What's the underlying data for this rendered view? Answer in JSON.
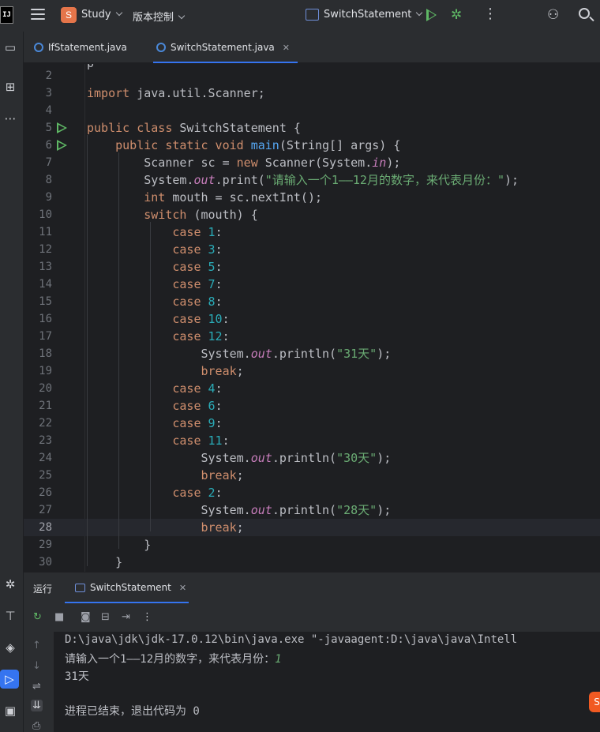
{
  "topbar": {
    "logo": "IJ",
    "project_badge": "S",
    "project_name": "Study",
    "vcs_label": "版本控制",
    "run_config": "SwitchStatement"
  },
  "tabs": [
    {
      "label": "IfStatement.java",
      "active": false
    },
    {
      "label": "SwitchStatement.java",
      "active": true
    }
  ],
  "editor": {
    "current_line": 28,
    "lines": [
      {
        "n": "2",
        "html": ""
      },
      {
        "n": "3",
        "html": "<span class=\"kw\">import</span> java.util.Scanner;"
      },
      {
        "n": "4",
        "html": ""
      },
      {
        "n": "5",
        "html": "<span class=\"kw\">public class</span> SwitchStatement {",
        "run": true
      },
      {
        "n": "6",
        "html": "    <span class=\"kw\">public static void</span> <span class=\"fn\">main</span>(String[] args) {",
        "run": true
      },
      {
        "n": "7",
        "html": "        Scanner sc = <span class=\"kw\">new</span> Scanner(System.<span class=\"st\">in</span>);"
      },
      {
        "n": "8",
        "html": "        System.<span class=\"st\">out</span>.print(<span class=\"str\">\"请输入一个1——12月的数字，来代表月份：\"</span>);"
      },
      {
        "n": "9",
        "html": "        <span class=\"kw\">int</span> mouth = sc.nextInt();"
      },
      {
        "n": "10",
        "html": "        <span class=\"kw\">switch</span> (mouth) {"
      },
      {
        "n": "11",
        "html": "            <span class=\"kw\">case</span> <span class=\"num\">1</span>:"
      },
      {
        "n": "12",
        "html": "            <span class=\"kw\">case</span> <span class=\"num\">3</span>:"
      },
      {
        "n": "13",
        "html": "            <span class=\"kw\">case</span> <span class=\"num\">5</span>:"
      },
      {
        "n": "14",
        "html": "            <span class=\"kw\">case</span> <span class=\"num\">7</span>:"
      },
      {
        "n": "15",
        "html": "            <span class=\"kw\">case</span> <span class=\"num\">8</span>:"
      },
      {
        "n": "16",
        "html": "            <span class=\"kw\">case</span> <span class=\"num\">10</span>:"
      },
      {
        "n": "17",
        "html": "            <span class=\"kw\">case</span> <span class=\"num\">12</span>:"
      },
      {
        "n": "18",
        "html": "                System.<span class=\"st\">out</span>.println(<span class=\"str\">\"31天\"</span>);"
      },
      {
        "n": "19",
        "html": "                <span class=\"kw\">break</span>;"
      },
      {
        "n": "20",
        "html": "            <span class=\"kw\">case</span> <span class=\"num\">4</span>:"
      },
      {
        "n": "21",
        "html": "            <span class=\"kw\">case</span> <span class=\"num\">6</span>:"
      },
      {
        "n": "22",
        "html": "            <span class=\"kw\">case</span> <span class=\"num\">9</span>:"
      },
      {
        "n": "23",
        "html": "            <span class=\"kw\">case</span> <span class=\"num\">11</span>:"
      },
      {
        "n": "24",
        "html": "                System.<span class=\"st\">out</span>.println(<span class=\"str\">\"30天\"</span>);"
      },
      {
        "n": "25",
        "html": "                <span class=\"kw\">break</span>;"
      },
      {
        "n": "26",
        "html": "            <span class=\"kw\">case</span> <span class=\"num\">2</span>:"
      },
      {
        "n": "27",
        "html": "                System.<span class=\"st\">out</span>.println(<span class=\"str\">\"28天\"</span>);"
      },
      {
        "n": "28",
        "html": "                <span class=\"kw\">break</span>;"
      },
      {
        "n": "29",
        "html": "        }"
      },
      {
        "n": "30",
        "html": "    }"
      }
    ]
  },
  "run_panel": {
    "title": "运行",
    "tab_label": "SwitchStatement",
    "console": {
      "command": "D:\\java\\jdk\\jdk-17.0.12\\bin\\java.exe \"-javaagent:D:\\java\\java\\Intell",
      "prompt": "请输入一个1——12月的数字，来代表月份：",
      "input": "1",
      "output": "31天",
      "exit": "进程已结束，退出代码为 0"
    }
  },
  "notification_badge": "S"
}
